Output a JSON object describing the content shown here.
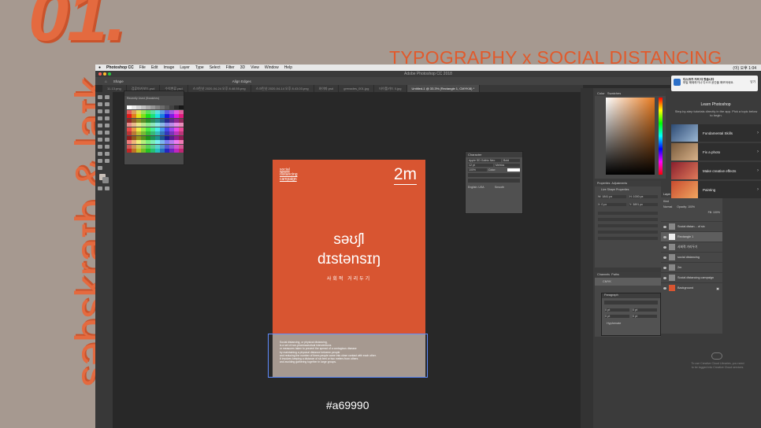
{
  "slide": {
    "number": "01.",
    "headline": "TYPOGRAPHY x SOCIAL DISTANCING",
    "vertical_text": "səbskraɪb & laɪk",
    "hex_label": "#a69990"
  },
  "colors": {
    "background": "#a69990",
    "accent": "#d85531",
    "selection": "#5f8cff"
  },
  "app": {
    "menubar": [
      "Photoshop CC",
      "File",
      "Edit",
      "Image",
      "Layer",
      "Type",
      "Select",
      "Filter",
      "3D",
      "View",
      "Window",
      "Help"
    ],
    "clock": "(이) 오후 1:04",
    "title": "Adobe Photoshop CC 2018",
    "options_tool": "Shape",
    "options_align": "Align Edges",
    "tabs": [
      "11-13.png",
      "검류마카보드.psd",
      "수억변류.psd",
      "스크린샷 2020-04-24 오후 8.48.55.png",
      "스크린샷 2020-04-14 오후 8.43.03.png",
      "와이파.psd",
      "grenades_001.jpg",
      "타이틀카드 0.jpg",
      "Untitled-1 @ 33.3% (Rectangle 1, CMYK/8) *"
    ],
    "swatches_label": "Recently Used (Swatches)"
  },
  "poster": {
    "top_left": [
      "social",
      "distancing",
      "campaign"
    ],
    "distance": "2m",
    "ipa_line1": "səʊʃl",
    "ipa_line2": "dɪstənsɪŋ",
    "korean": "사회적 거리두기",
    "body": [
      "Social distancing, or physical distancing,",
      "is a set of non-pharmaceutical interventions",
      "or measures taken to prevent the spread of a contagious disease",
      "by maintaining a physical distance between people",
      "and reducing the number of times people come into close contact with each other.",
      "It involves keeping a distance of six feet or two meters from others",
      "and avoiding gathering together in large groups."
    ]
  },
  "character_panel": {
    "title": "Character",
    "font": "Apple SD Gothic Neo",
    "style": "Bold",
    "size": "12 pt",
    "tracking": "Metrics",
    "scale": "100%",
    "color_label": "Color:",
    "language": "English: USA",
    "aa": "Smooth"
  },
  "color_panel": {
    "tabs": [
      "Color",
      "Swatches"
    ]
  },
  "properties_panel": {
    "tabs": [
      "Properties",
      "Adjustments"
    ],
    "section": "Live Shape Properties",
    "w": "W: 1841 px",
    "h": "H: 1000 px",
    "x": "X: 0 px",
    "y": "Y: 3891 px"
  },
  "layers_panel": {
    "title": "Layers",
    "kind": "Kind",
    "mode": "Normal",
    "opacity": "Opacity: 100%",
    "fill": "Fill: 100%",
    "layers": [
      {
        "name": "Social distan... of six",
        "selected": false
      },
      {
        "name": "Rectangle 1",
        "selected": true
      },
      {
        "name": "사회적 거리두기",
        "selected": false
      },
      {
        "name": "social distancing",
        "selected": false
      },
      {
        "name": "2m",
        "selected": false
      },
      {
        "name": "Social distancing campaign",
        "selected": false
      },
      {
        "name": "Background",
        "selected": false
      }
    ]
  },
  "channels_panel": {
    "tabs": [
      "Channels",
      "Paths"
    ],
    "item": "CMYK"
  },
  "paragraph_panel": {
    "title": "Paragraph",
    "hyphenate": "Hyphenate",
    "values": [
      "0 pt",
      "0 pt",
      "0 pt",
      "0 pt"
    ]
  },
  "learn_panel": {
    "notice": "디스크가 거의 다 찼습니다",
    "notice_body": "파일 해제하거나 디스크 공간을 확보하세요.",
    "notice_close": "닫기",
    "title": "Learn Photoshop",
    "subtitle": "Step-by-step tutorials directly in the app. Pick a topic below to begin.",
    "items": [
      "Fundamental Skills",
      "Fix a photo",
      "Make creative effects",
      "Painting"
    ],
    "cc_note": "To use Creative Cloud Libraries, you need to be logged into Creative Cloud services."
  }
}
